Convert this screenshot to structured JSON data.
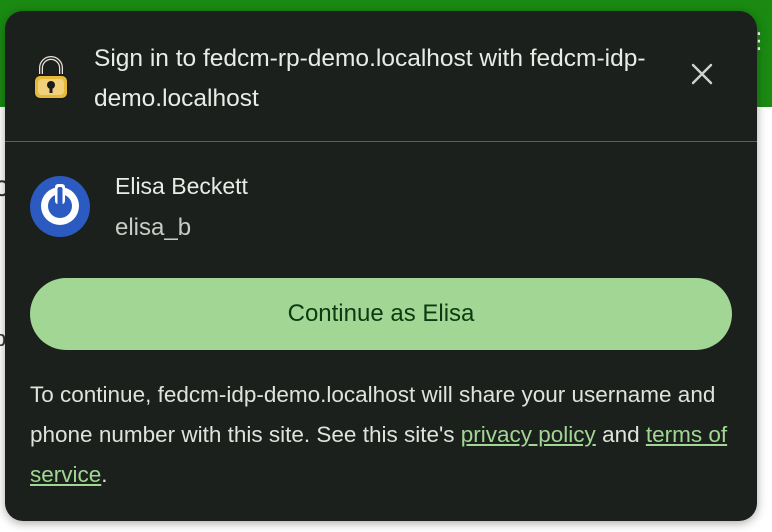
{
  "dialog": {
    "title": "Sign in to fedcm-rp-demo.localhost with fedcm-idp-demo.localhost",
    "idp_icon": "lock-icon",
    "close_icon": "close-icon"
  },
  "account": {
    "avatar_icon": "power-icon",
    "name": "Elisa Beckett",
    "username": "elisa_b"
  },
  "continue_button": {
    "label": "Continue as Elisa"
  },
  "disclosure": {
    "text_before": "To continue, fedcm-idp-demo.localhost will share your username and phone number with this site. See this site's ",
    "privacy_link": "privacy policy",
    "and_text": " and ",
    "terms_link": "terms of service",
    "end_text": "."
  },
  "colors": {
    "dialog_bg": "#1c201c",
    "accent": "#a1d695",
    "avatar_bg": "#2b5bc0",
    "page_header": "#1a8a12"
  }
}
